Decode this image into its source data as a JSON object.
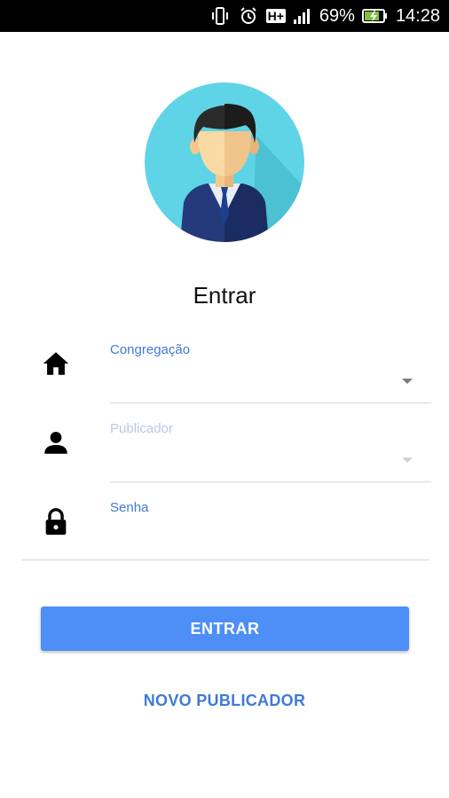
{
  "status_bar": {
    "network": "H+",
    "battery": "69%",
    "time": "14:28",
    "icons": [
      "vibrate-icon",
      "alarm-icon",
      "network-type-icon",
      "signal-icon",
      "battery-charging-icon"
    ]
  },
  "avatar": {
    "icon": "user-avatar-icon"
  },
  "title": "Entrar",
  "form": {
    "congregacao": {
      "label": "Congregação",
      "icon": "home-icon",
      "value": ""
    },
    "publicador": {
      "label": "Publicador",
      "icon": "person-icon",
      "value": ""
    },
    "senha": {
      "label": "Senha",
      "icon": "lock-icon",
      "value": ""
    }
  },
  "buttons": {
    "entrar": "ENTRAR",
    "novo_publicador": "NOVO PUBLICADOR"
  },
  "colors": {
    "accent": "#4d8ff6",
    "label_blue": "#3f7ad6",
    "avatar_bg": "#5fd4e6"
  }
}
